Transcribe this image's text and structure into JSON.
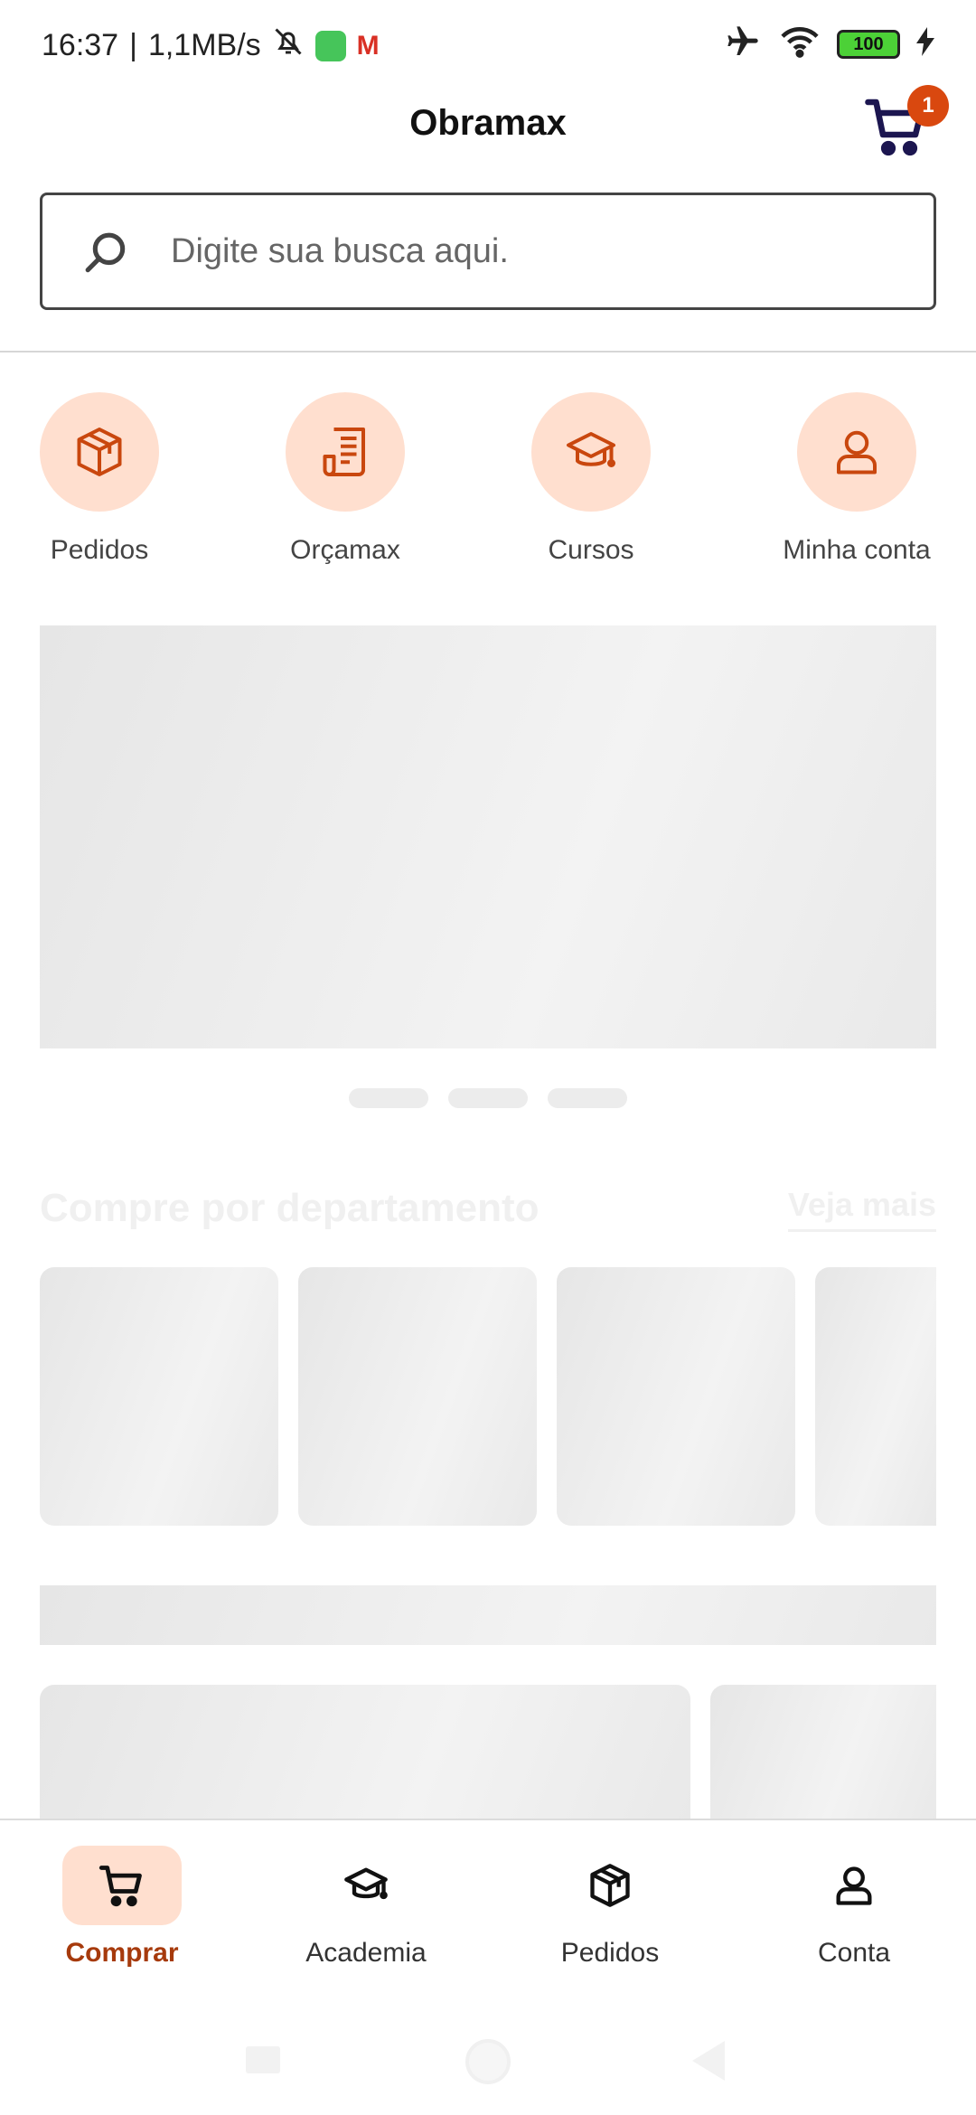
{
  "status_bar": {
    "time": "16:37",
    "separator": "|",
    "network_speed": "1,1MB/s",
    "battery_level": "100",
    "icons": [
      "mute-bell-icon",
      "app-notification-icon",
      "gmail-icon",
      "airplane-icon",
      "wifi-icon",
      "battery-icon",
      "charging-icon"
    ]
  },
  "header": {
    "title": "Obramax",
    "cart_count": "1"
  },
  "search": {
    "placeholder": "Digite sua busca aqui."
  },
  "quick_links": [
    {
      "label": "Pedidos",
      "icon": "box-icon"
    },
    {
      "label": "Orçamax",
      "icon": "document-icon"
    },
    {
      "label": "Cursos",
      "icon": "graduation-cap-icon"
    },
    {
      "label": "Minha conta",
      "icon": "user-icon"
    }
  ],
  "sections": {
    "departments_title": "Compre por departamento",
    "see_more": "Veja mais"
  },
  "bottom_nav": [
    {
      "label": "Comprar",
      "icon": "cart-icon",
      "active": true
    },
    {
      "label": "Academia",
      "icon": "graduation-cap-icon",
      "active": false
    },
    {
      "label": "Pedidos",
      "icon": "box-icon",
      "active": false
    },
    {
      "label": "Conta",
      "icon": "user-icon",
      "active": false
    }
  ],
  "colors": {
    "accent": "#d9480f",
    "accent_light": "#ffdfcf",
    "active_label": "#a63a0c"
  }
}
